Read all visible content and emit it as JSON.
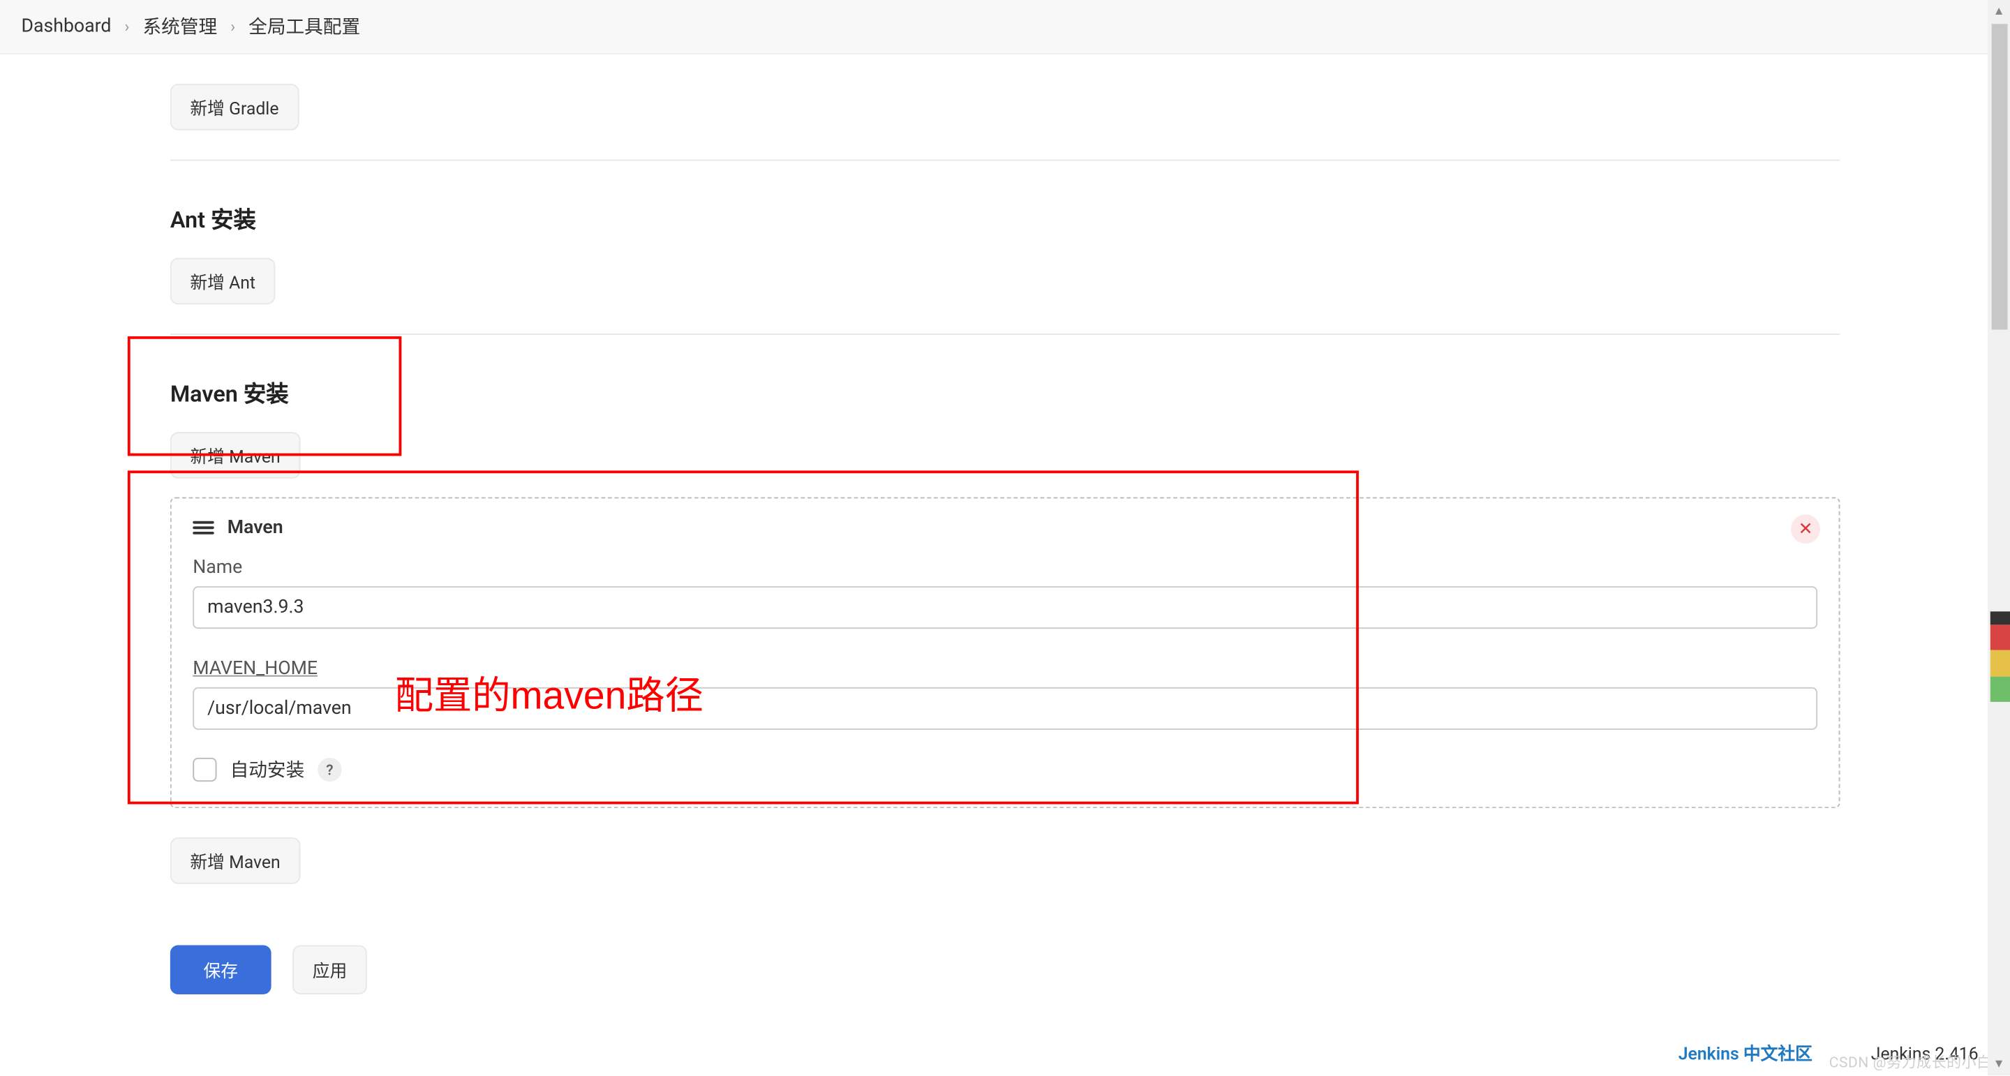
{
  "breadcrumb": {
    "items": [
      "Dashboard",
      "系统管理",
      "全局工具配置"
    ]
  },
  "sections": {
    "gradle": {
      "add_button": "新增 Gradle"
    },
    "ant": {
      "heading": "Ant 安装",
      "add_button": "新增 Ant"
    },
    "maven": {
      "heading": "Maven 安装",
      "add_button": "新增 Maven",
      "add_button_bottom": "新增 Maven"
    }
  },
  "installer": {
    "title": "Maven",
    "name_label": "Name",
    "name_value": "maven3.9.3",
    "home_label": "MAVEN_HOME",
    "home_value": "/usr/local/maven",
    "auto_install_label": "自动安装"
  },
  "annotation": {
    "maven_path": "配置的maven路径"
  },
  "buttons": {
    "save": "保存",
    "apply": "应用"
  },
  "footer": {
    "community": "Jenkins 中文社区",
    "version": "Jenkins 2.416"
  },
  "watermark": "CSDN @努力成长的小白"
}
